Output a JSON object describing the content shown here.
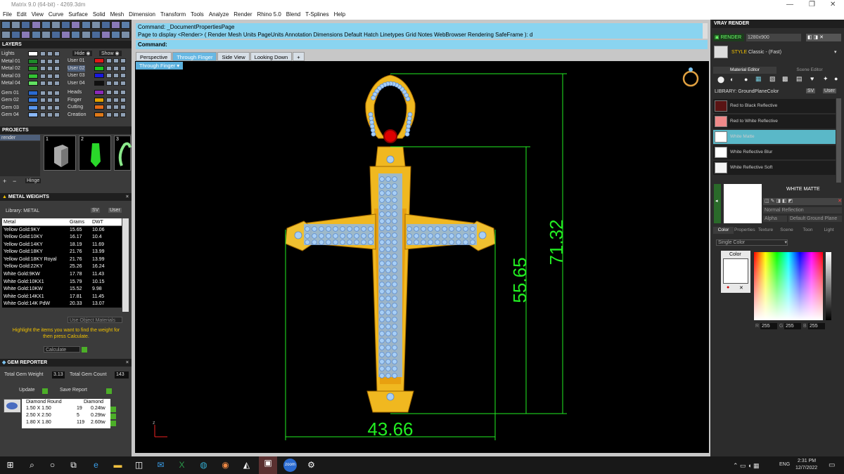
{
  "app": {
    "title": "Matrix 9.0 (64-bit) - 4269.3dm"
  },
  "menu": [
    "File",
    "Edit",
    "View",
    "Curve",
    "Surface",
    "Solid",
    "Mesh",
    "Dimension",
    "Transform",
    "Tools",
    "Analyze",
    "Render",
    "Rhino 5.0",
    "Blend",
    "T-Splines",
    "Help"
  ],
  "layers": {
    "header": "LAYERS",
    "hide": "Hide",
    "show": "Show",
    "left": [
      {
        "name": "Lights",
        "color": "#ffffff"
      },
      {
        "name": "Metal 01",
        "color": "#1e8a2a"
      },
      {
        "name": "Metal 02",
        "color": "#2a9a2a"
      },
      {
        "name": "Metal 03",
        "color": "#34c234"
      },
      {
        "name": "Metal 04",
        "color": "#62e062"
      },
      {
        "name": "Gem 01",
        "color": "#2a6ad0"
      },
      {
        "name": "Gem 02",
        "color": "#3c7ee0"
      },
      {
        "name": "Gem 03",
        "color": "#5a98f0"
      },
      {
        "name": "Gem 04",
        "color": "#8ab8f8"
      }
    ],
    "right": [
      {
        "name": "User 01",
        "color": "#e01818"
      },
      {
        "name": "User 02",
        "color": "#18c818"
      },
      {
        "name": "User 03",
        "color": "#1818e0"
      },
      {
        "name": "User 04",
        "color": "#101010"
      },
      {
        "name": "Heads",
        "color": "#8a2ab8"
      },
      {
        "name": "Finger",
        "color": "#e0a000"
      },
      {
        "name": "Cutting",
        "color": "#e06a18"
      },
      {
        "name": "Creation",
        "color": "#e07a18"
      }
    ]
  },
  "projects": {
    "header": "PROJECTS",
    "item": "render",
    "thumbs": [
      "1",
      "2",
      "3"
    ],
    "hinge": "Hinge"
  },
  "metal_weights": {
    "header": "METAL WEIGHTS",
    "library": "Library: METAL",
    "sv": "SV",
    "user": "User",
    "columns": [
      "Metal",
      "Grams",
      "DWT"
    ],
    "rows": [
      [
        "Yellow Gold:9KY",
        "15.65",
        "10.06"
      ],
      [
        "Yellow Gold:10KY",
        "16.17",
        "10.4"
      ],
      [
        "Yellow Gold:14KY",
        "18.19",
        "11.69"
      ],
      [
        "Yellow Gold:18KY",
        "21.76",
        "13.99"
      ],
      [
        "Yellow Gold:18KY Royal",
        "21.76",
        "13.99"
      ],
      [
        "Yellow Gold:22KY",
        "25.26",
        "16.24"
      ],
      [
        "White Gold:9KW",
        "17.78",
        "11.43"
      ],
      [
        "White Gold:10KX1",
        "15.79",
        "10.15"
      ],
      [
        "White Gold:10KW",
        "15.52",
        "9.98"
      ],
      [
        "White Gold:14KX1",
        "17.81",
        "11.45"
      ],
      [
        "White Gold:14K PdW",
        "20.33",
        "13.07"
      ]
    ],
    "use_object_materials": "Use Object Materials",
    "hint": "Highlight the items you want to find the weight for then press Calculate.",
    "calculate": "Calculate"
  },
  "gem_reporter": {
    "header": "GEM REPORTER",
    "total_weight_label": "Total Gem Weight",
    "total_weight": "3.13",
    "total_count_label": "Total Gem Count",
    "total_count": "143",
    "update": "Update",
    "save_report": "Save Report",
    "col1": "Diamond Round",
    "col2": "Diamond",
    "rows": [
      [
        "1.50 X 1.50",
        "19",
        "0.24tw"
      ],
      [
        "2.50 X 2.50",
        "5",
        "0.29tw"
      ],
      [
        "1.80 X 1.80",
        "119",
        "2.60tw"
      ]
    ]
  },
  "command": {
    "line1": "Command: _DocumentPropertiesPage",
    "line2": "Page to display <Render> ( Render Mesh Units PageUnits Annotation Dimensions Default Hatch Linetypes Grid Notes WebBrowser Rendering SafeFrame ): d",
    "prompt": "Command:"
  },
  "viewport_tabs": [
    "Perspective",
    "Through Finger",
    "Side View",
    "Looking Down"
  ],
  "viewport_tab_add": "+",
  "active_view": "Through Finger",
  "dimensions": {
    "width": "43.66",
    "height_inner": "55.65",
    "height_total": "71.32"
  },
  "axis": "z",
  "vray": {
    "header": "VRAY RENDER",
    "render": "RENDER",
    "resolution": "1280x900",
    "style_label": "STYLE",
    "style": "Classic - (Fast)",
    "tabs": [
      "Material Editor",
      "Scene Editor"
    ],
    "library": "LIBRARY: GroundPlaneColor",
    "sv": "SV",
    "user": "User",
    "materials": [
      {
        "name": "Red to Black Reflective",
        "color": "#5a1414"
      },
      {
        "name": "Red to White Reflective",
        "color": "#f08a8a"
      },
      {
        "name": "White Matte",
        "color": "#ffffff"
      },
      {
        "name": "White Reflective Blur",
        "color": "#ffffff"
      },
      {
        "name": "White Reflective Soft",
        "color": "#f4f4f4"
      }
    ],
    "selected": "WHITE MATTE",
    "reflection": "Normal Reflection",
    "alpha": "Alpha",
    "ground": "Default Ground Plane",
    "subtabs": [
      "Color",
      "Properties",
      "Texture",
      "Scene",
      "Toon",
      "Light"
    ],
    "color_mode": "Single Color",
    "color_label": "Color",
    "rgb": [
      "255",
      "255",
      "255"
    ]
  },
  "taskbar": {
    "lang": "ENG",
    "time": "2:31 PM",
    "date": "12/7/2022"
  }
}
